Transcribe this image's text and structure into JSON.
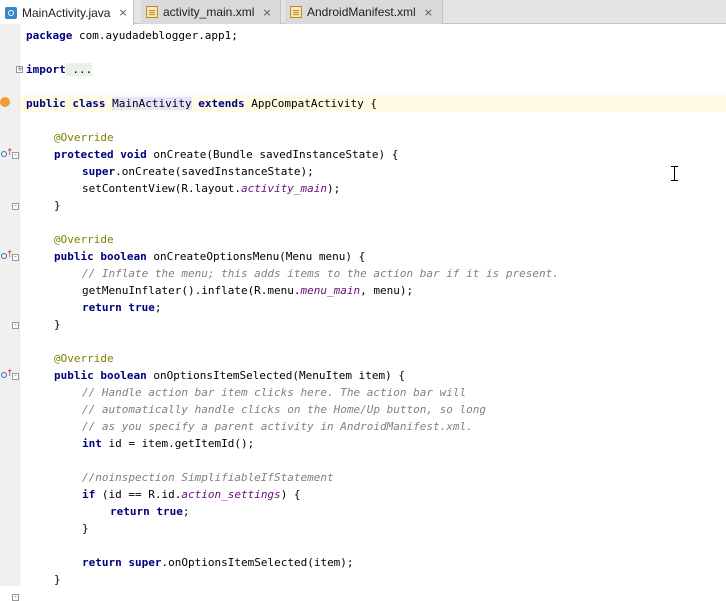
{
  "tabs": [
    {
      "label": "MainActivity.java",
      "icon": "java-file-icon",
      "close": "×",
      "active": true
    },
    {
      "label": "activity_main.xml",
      "icon": "xml-file-icon",
      "close": "×",
      "active": false
    },
    {
      "label": "AndroidManifest.xml",
      "icon": "xml-file-icon",
      "close": "×",
      "active": false
    }
  ],
  "code": {
    "l1_kw": "package",
    "l1_rest": " com.ayudadeblogger.app1;",
    "l2_kw": "import",
    "l2_fold": " ...",
    "l3_kw1": "public",
    "l3_kw2": "class",
    "l3_name": "MainActivity",
    "l3_kw3": "extends",
    "l3_rest": " AppCompatActivity {",
    "ann": "@Override",
    "l5_kw1": "protected",
    "l5_kw2": "void",
    "l5_rest": " onCreate(Bundle savedInstanceState) {",
    "l6_kw": "super",
    "l6_rest": ".onCreate(savedInstanceState);",
    "l7_a": "setContentView(R.layout.",
    "l7_f": "activity_main",
    "l7_b": ");",
    "close_brace": "}",
    "l9_kw1": "public",
    "l9_kw2": "boolean",
    "l9_rest": " onCreateOptionsMenu(Menu menu) {",
    "l10_cmt": "// Inflate the menu; this adds items to the action bar if it is present.",
    "l11_a": "getMenuInflater().inflate(R.menu.",
    "l11_f": "menu_main",
    "l11_b": ", menu);",
    "l12_kw1": "return",
    "l12_kw2": "true",
    "l12_rest": ";",
    "l14_kw1": "public",
    "l14_kw2": "boolean",
    "l14_rest": " onOptionsItemSelected(MenuItem item) {",
    "l15_cmt": "// Handle action bar item clicks here. The action bar will",
    "l16_cmt": "// automatically handle clicks on the Home/Up button, so long",
    "l17_cmt": "// as you specify a parent activity in AndroidManifest.xml.",
    "l18_kw": "int",
    "l18_rest": " id = item.getItemId();",
    "l19_cmt": "//noinspection SimplifiableIfStatement",
    "l20_kw": "if",
    "l20_a": " (id == R.id.",
    "l20_f": "action_settings",
    "l20_b": ") {",
    "l21_kw1": "return",
    "l21_kw2": "true",
    "l21_rest": ";",
    "l22": "}",
    "l23_kw1": "return",
    "l23_kw2": "super",
    "l23_rest": ".onOptionsItemSelected(item);",
    "l24": "}"
  },
  "colors": {
    "keyword": "#000080",
    "annotation": "#808000",
    "comment": "#808080",
    "field": "#660e7a",
    "current_line": "#fffae3"
  }
}
